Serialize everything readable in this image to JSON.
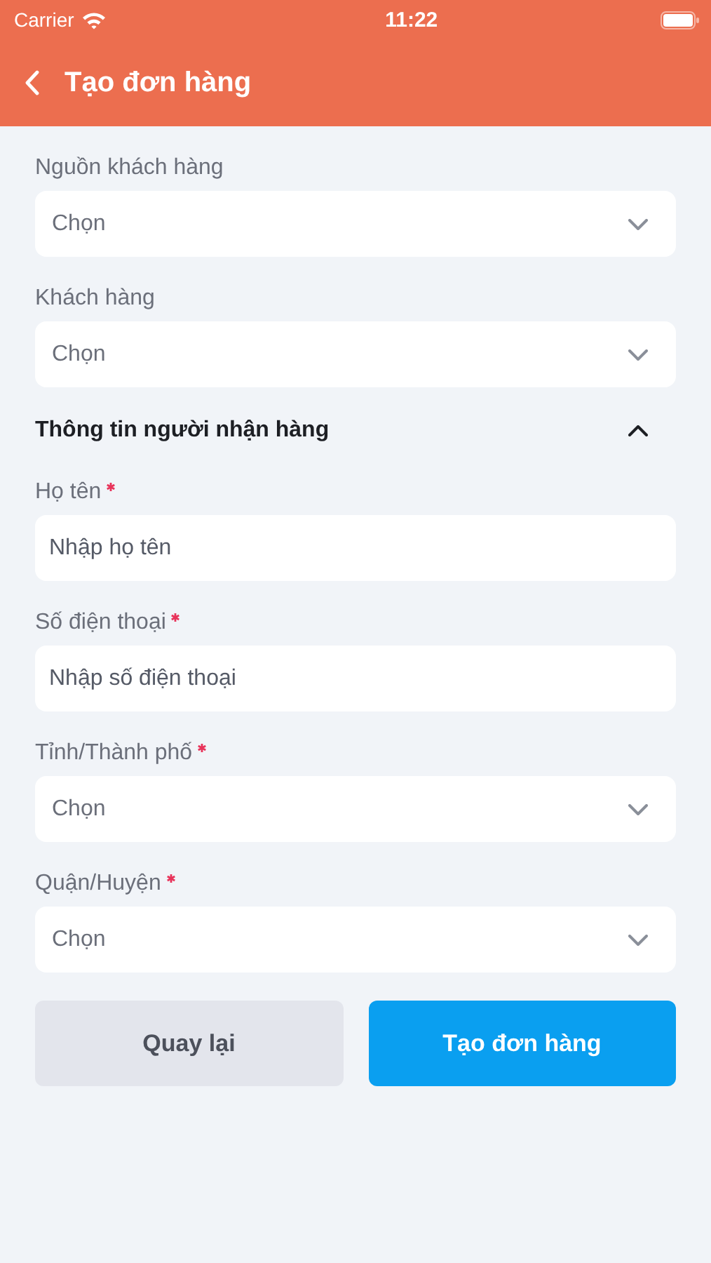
{
  "status_bar": {
    "carrier": "Carrier",
    "time": "11:22"
  },
  "header": {
    "title": "Tạo đơn hàng"
  },
  "top_fields": [
    {
      "kind": "select",
      "label": "Nguồn khách hàng",
      "required": false,
      "placeholder": "Chọn"
    },
    {
      "kind": "select",
      "label": "Khách hàng",
      "required": false,
      "placeholder": "Chọn"
    }
  ],
  "section": {
    "title": "Thông tin người nhận hàng",
    "expanded": true,
    "fields": [
      {
        "kind": "text",
        "label": "Họ tên",
        "required": true,
        "placeholder": "Nhập họ tên"
      },
      {
        "kind": "text",
        "label": "Số điện thoại",
        "required": true,
        "placeholder": "Nhập số điện thoại"
      },
      {
        "kind": "select",
        "label": "Tỉnh/Thành phố",
        "required": true,
        "placeholder": "Chọn"
      },
      {
        "kind": "select",
        "label": "Quận/Huyện",
        "required": true,
        "placeholder": "Chọn"
      }
    ]
  },
  "buttons": [
    {
      "kind": "secondary",
      "label": "Quay lại"
    },
    {
      "kind": "primary",
      "label": "Tạo đơn hàng"
    }
  ]
}
